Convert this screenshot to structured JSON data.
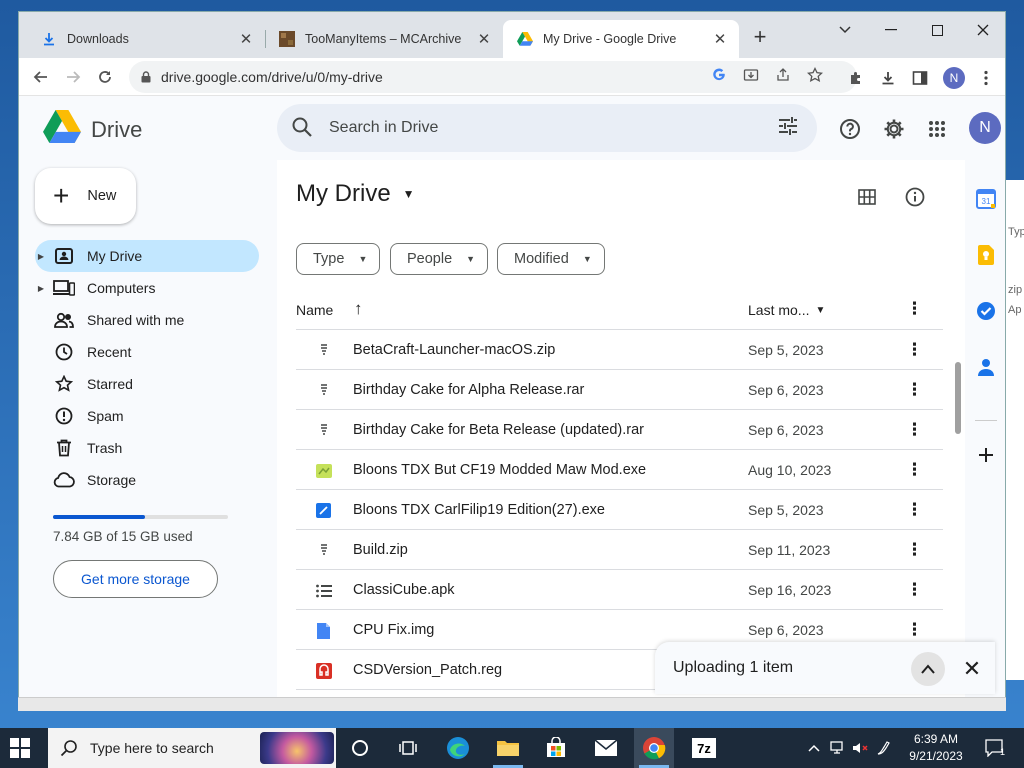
{
  "browser": {
    "tabs": [
      {
        "title": "Downloads",
        "icon": "download-icon"
      },
      {
        "title": "TooManyItems – MCArchive",
        "icon": "mcarchive-favicon"
      },
      {
        "title": "My Drive - Google Drive",
        "icon": "google-drive-favicon",
        "active": true
      }
    ],
    "url": "drive.google.com/drive/u/0/my-drive",
    "profile_initial": "N"
  },
  "drive": {
    "app_name": "Drive",
    "search_placeholder": "Search in Drive",
    "avatar_initial": "N",
    "new_label": "New",
    "nav": [
      {
        "label": "My Drive",
        "icon": "my-drive-icon",
        "active": true,
        "expandable": true
      },
      {
        "label": "Computers",
        "icon": "computers-icon",
        "expandable": true
      },
      {
        "label": "Shared with me",
        "icon": "shared-icon"
      },
      {
        "label": "Recent",
        "icon": "clock-icon"
      },
      {
        "label": "Starred",
        "icon": "star-icon"
      },
      {
        "label": "Spam",
        "icon": "spam-icon"
      },
      {
        "label": "Trash",
        "icon": "trash-icon"
      },
      {
        "label": "Storage",
        "icon": "cloud-icon"
      }
    ],
    "storage": {
      "used_text": "7.84 GB of 15 GB used",
      "used_fraction": 0.523,
      "cta": "Get more storage"
    },
    "title": "My Drive",
    "filters": [
      "Type",
      "People",
      "Modified"
    ],
    "columns": {
      "name": "Name",
      "modified": "Last mo..."
    },
    "files": [
      {
        "name": "BetaCraft-Launcher-macOS.zip",
        "date": "Sep 5, 2023",
        "icon": "zip-icon"
      },
      {
        "name": "Birthday Cake for Alpha Release.rar",
        "date": "Sep 6, 2023",
        "icon": "zip-icon"
      },
      {
        "name": "Birthday Cake for Beta Release (updated).rar",
        "date": "Sep 6, 2023",
        "icon": "zip-icon"
      },
      {
        "name": "Bloons TDX But CF19 Modded Maw Mod.exe",
        "date": "Aug 10, 2023",
        "icon": "exe-icon"
      },
      {
        "name": "Bloons TDX CarlFilip19 Edition(27).exe",
        "date": "Sep 5, 2023",
        "icon": "exe-blue-icon"
      },
      {
        "name": "Build.zip",
        "date": "Sep 11, 2023",
        "icon": "zip-icon"
      },
      {
        "name": "ClassiCube.apk",
        "date": "Sep 16, 2023",
        "icon": "list-icon"
      },
      {
        "name": "CPU Fix.img",
        "date": "Sep 6, 2023",
        "icon": "doc-icon"
      },
      {
        "name": "CSDVersion_Patch.reg",
        "date": "",
        "icon": "reg-icon"
      }
    ],
    "upload": {
      "text": "Uploading 1 item"
    }
  },
  "background_window": {
    "texts": [
      "Typ",
      "zip",
      "Ap"
    ]
  },
  "taskbar": {
    "search_placeholder": "Type here to search",
    "time": "6:39 AM",
    "date": "9/21/2023",
    "notifications": "1"
  }
}
